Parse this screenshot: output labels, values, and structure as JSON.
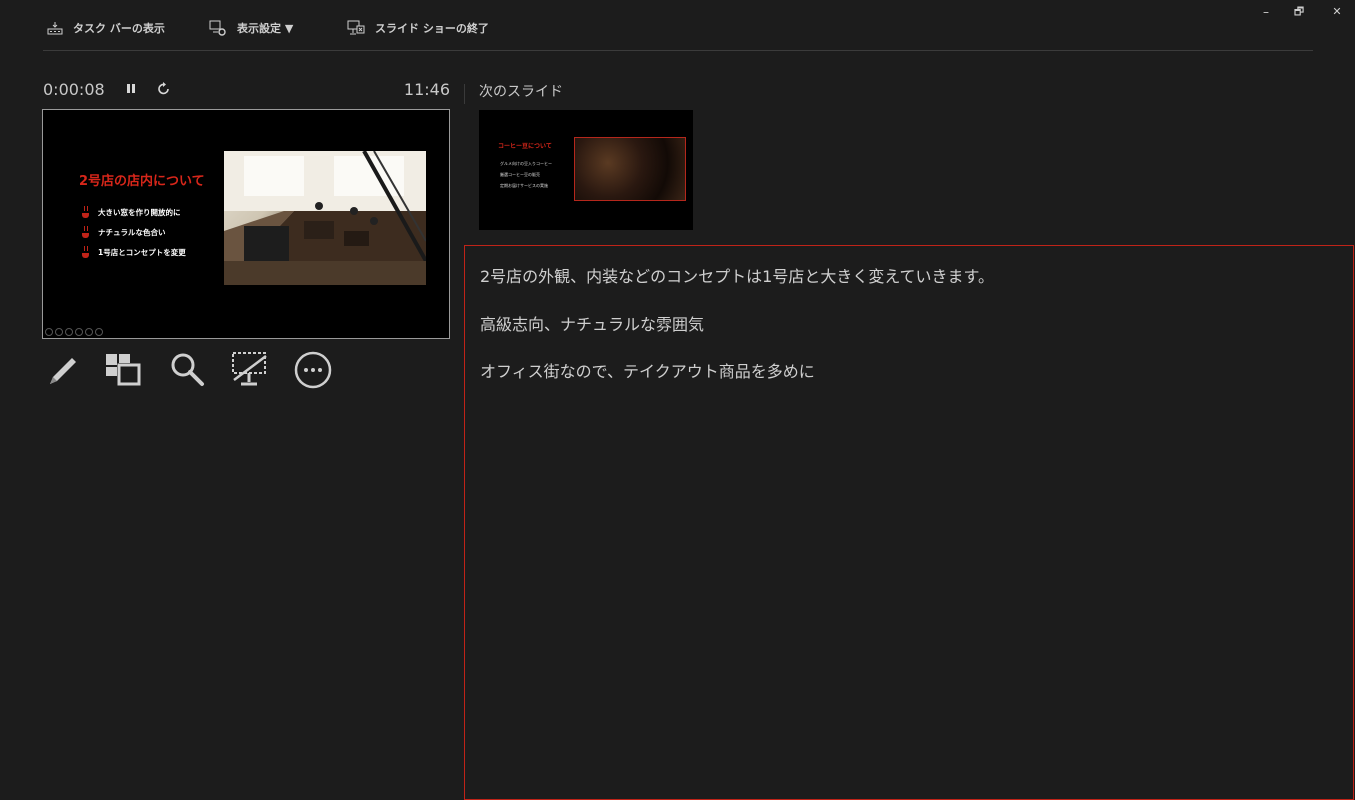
{
  "toolbar": {
    "taskbar_label": "タスク バーの表示",
    "display_settings_label": "表示設定 ▼",
    "end_show_label": "スライド ショーの終了"
  },
  "window": {
    "minimize_glyph": "–",
    "restore_glyph": "🗗",
    "close_glyph": "✕"
  },
  "timer": {
    "elapsed": "0:00:08",
    "pause_glyph": "⏸",
    "reset_glyph": "↻",
    "clock": "11:46"
  },
  "current_slide": {
    "title": "2号店の店内について",
    "bullets": [
      "大きい窓を作り開放的に",
      "ナチュラルな色合い",
      "1号店とコンセプトを変更"
    ]
  },
  "tools": [
    "pen-icon",
    "slides-grid-icon",
    "zoom-icon",
    "black-screen-icon",
    "more-options-icon"
  ],
  "next_slide": {
    "label": "次のスライド",
    "title": "コーヒー豆について",
    "bullets": [
      "グルメ向けの豆入りコーヒー",
      "厳選コーヒー豆の販売",
      "定期お届けサービスの実施"
    ]
  },
  "notes": {
    "lines": [
      "2号店の外観、内装などのコンセプトは1号店と大きく変えていきます。",
      "高級志向、ナチュラルな雰囲気",
      "オフィス街なので、テイクアウト商品を多めに"
    ]
  },
  "colors": {
    "background": "#1c1c1c",
    "accent_red": "#d7261a",
    "notes_border": "#c02318"
  }
}
